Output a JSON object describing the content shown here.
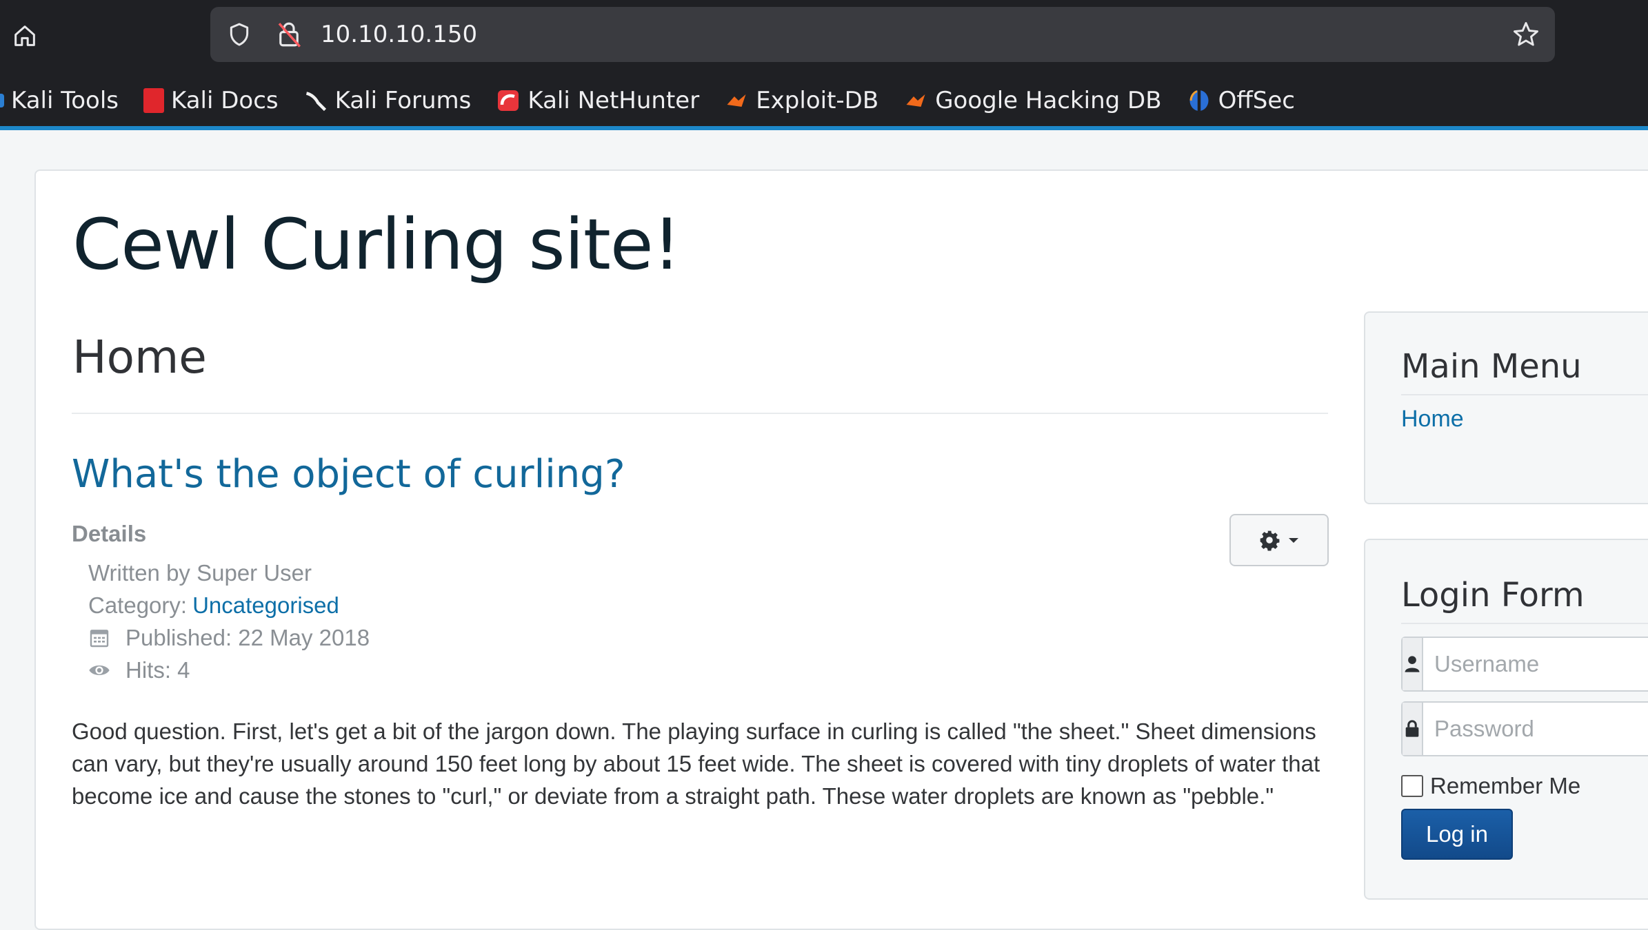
{
  "browser": {
    "url": "10.10.10.150",
    "bookmarks": [
      {
        "label": "Kali Tools",
        "icon": "kali-tools-icon"
      },
      {
        "label": "Kali Docs",
        "icon": "kali-docs-icon"
      },
      {
        "label": "Kali Forums",
        "icon": "kali-forums-icon"
      },
      {
        "label": "Kali NetHunter",
        "icon": "nethunter-icon"
      },
      {
        "label": "Exploit-DB",
        "icon": "exploit-db-icon"
      },
      {
        "label": "Google Hacking DB",
        "icon": "ghdb-icon"
      },
      {
        "label": "OffSec",
        "icon": "offsec-icon"
      }
    ],
    "colors": {
      "chrome": "#1f2024",
      "urlbar": "#3a3b40",
      "accent": "#1d88c9"
    }
  },
  "site": {
    "title": "Cewl Curling site!",
    "page_heading": "Home"
  },
  "article": {
    "title": "What's the object of curling?",
    "details_label": "Details",
    "written_by": "Written by Super User",
    "category_label": "Category:",
    "category": "Uncategorised",
    "published": "Published: 22 May 2018",
    "hits": "Hits: 4",
    "body": "Good question. First, let's get a bit of the jargon down. The playing surface in curling is called \"the sheet.\" Sheet dimensions can vary, but they're usually around 150 feet long by about 15 feet wide. The sheet is covered with tiny droplets of water that become ice and cause the stones to \"curl,\" or deviate from a straight path. These water droplets are known as \"pebble.\""
  },
  "main_menu": {
    "title": "Main Menu",
    "items": [
      {
        "label": "Home"
      }
    ]
  },
  "login_form": {
    "title": "Login Form",
    "username_placeholder": "Username",
    "password_placeholder": "Password",
    "remember_label": "Remember Me",
    "login_button": "Log in"
  }
}
